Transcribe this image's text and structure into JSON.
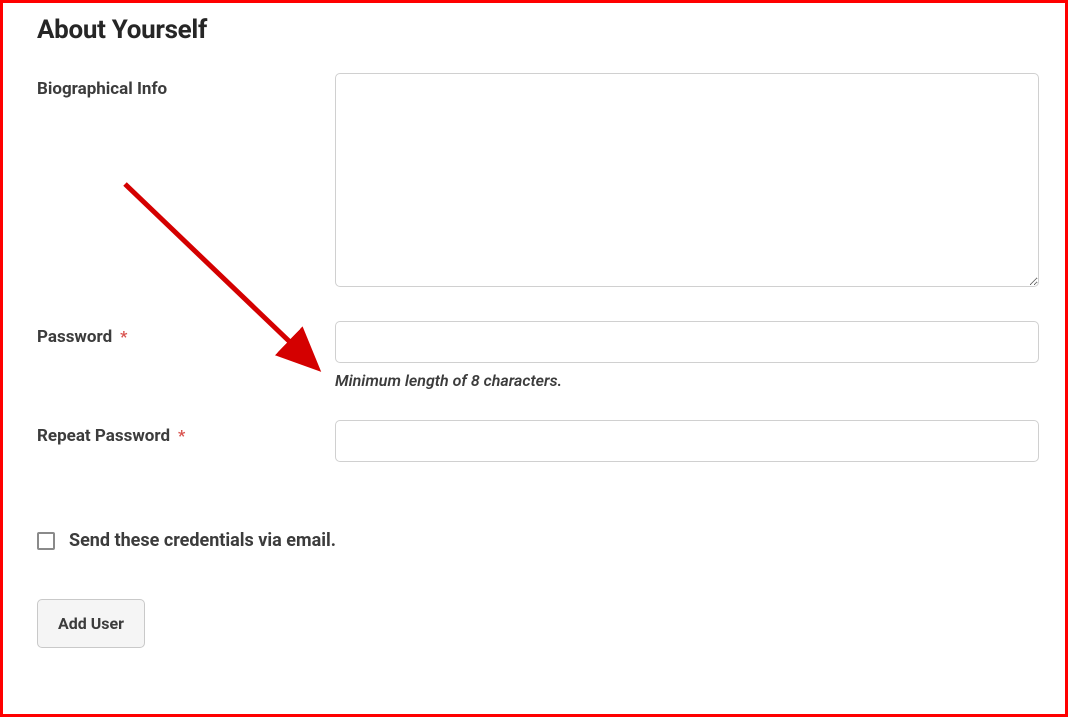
{
  "section": {
    "title": "About Yourself"
  },
  "fields": {
    "bio": {
      "label": "Biographical Info",
      "value": ""
    },
    "password": {
      "label": "Password",
      "required_mark": "*",
      "value": "",
      "hint": "Minimum length of 8 characters."
    },
    "repeat_password": {
      "label": "Repeat Password",
      "required_mark": "*",
      "value": ""
    }
  },
  "checkbox": {
    "label": "Send these credentials via email.",
    "checked": false
  },
  "submit": {
    "label": "Add User"
  }
}
